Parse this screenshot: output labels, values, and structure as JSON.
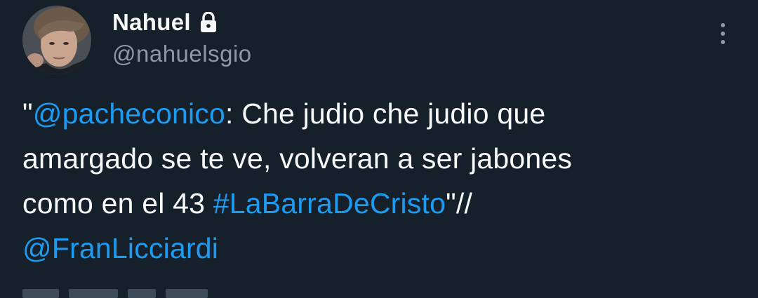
{
  "author": {
    "display_name": "Nahuel",
    "handle": "@nahuelsgio",
    "protected_icon": "lock-icon",
    "avatar_icon": "profile-photo"
  },
  "menu": {
    "icon": "more-vertical-icon"
  },
  "tweet": {
    "line1": {
      "quote_open": "\"",
      "mention": "@pacheconico",
      "text": ": Che judio che judio que"
    },
    "line2": {
      "text": "amargado se te ve, volveran a ser jabones"
    },
    "line3": {
      "text": "como en el 43 ",
      "hashtag": "#LaBarraDeCristo",
      "suffix": "\"//"
    },
    "line4": {
      "mention": "@FranLicciardi"
    }
  },
  "colors": {
    "background": "#15202b",
    "text": "#f7f9f9",
    "secondary_text": "#8b98a5",
    "link": "#1d9bf0"
  }
}
